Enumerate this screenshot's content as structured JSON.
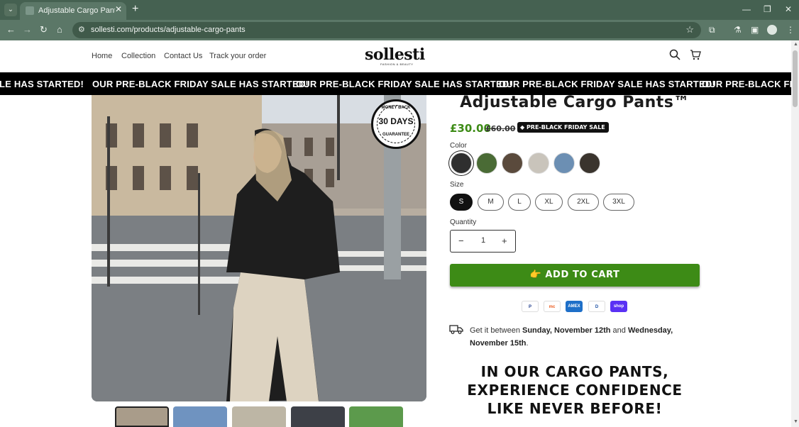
{
  "browser": {
    "tab_title": "Adjustable Cargo Pants™ – Sollesti",
    "url": "sollesti.com/products/adjustable-cargo-pants"
  },
  "header": {
    "nav": [
      "Home",
      "Collection",
      "Contact Us",
      "Track your order"
    ],
    "logo": "sollesti",
    "logo_tagline": "FASHION & BEAUTY"
  },
  "announcement": {
    "text": "OUR PRE-BLACK FRIDAY SALE HAS STARTED!",
    "leading_fragment": "LE HAS STARTED!",
    "trailing_fragment": "OUR PRE-BLACK FRIDA"
  },
  "media": {
    "badge_top": "MONEY BACK",
    "badge_main": "30 DAYS",
    "badge_bottom": "GUARANTEE",
    "thumbnail_count": 5
  },
  "product": {
    "title": "Adjustable Cargo Pants™",
    "price": "£30.00",
    "compare_price": "£60.00",
    "sale_badge": "PRE-BLACK FRIDAY SALE",
    "color_label": "Color",
    "colors": [
      "#2f2f2f",
      "#4a6b35",
      "#5a4a3c",
      "#c9c4bb",
      "#6c8fb3",
      "#3a342d"
    ],
    "size_label": "Size",
    "sizes": [
      "S",
      "M",
      "L",
      "XL",
      "2XL",
      "3XL"
    ],
    "selected_size": "S",
    "quantity_label": "Quantity",
    "quantity": "1",
    "add_to_cart": "👉 ADD TO CART",
    "payment_methods": [
      "P",
      "mc",
      "AMEX",
      "D",
      "shop"
    ],
    "delivery": {
      "prefix": "Get it between ",
      "start": "Sunday, November 12th",
      "middle": " and ",
      "end": "Wednesday, November 15th",
      "suffix": "."
    },
    "promo_heading": "IN OUR CARGO PANTS, EXPERIENCE CONFIDENCE LIKE NEVER BEFORE!"
  },
  "colors": {
    "brand_green": "#3d8b16",
    "browser_chrome": "#5b7767"
  }
}
